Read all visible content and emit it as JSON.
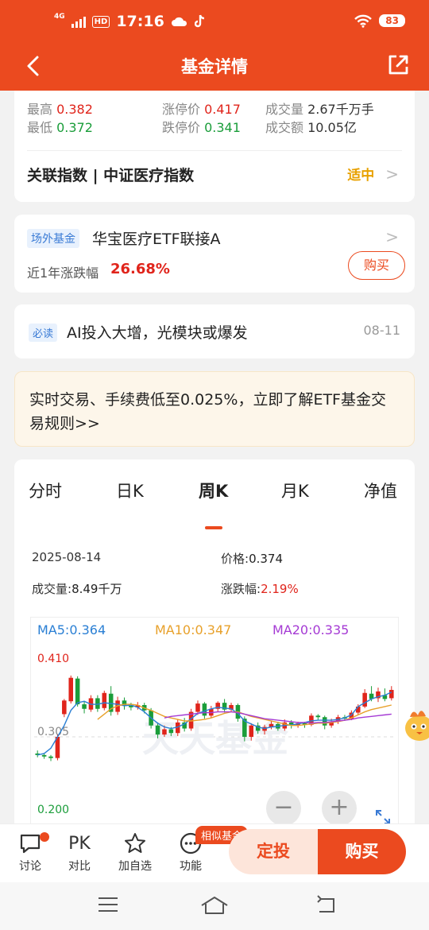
{
  "status_bar": {
    "time": "17:16",
    "network": "4G",
    "hd": "HD",
    "battery": "83"
  },
  "nav": {
    "title": "基金详情"
  },
  "quote": {
    "high_label": "最高",
    "high_value": "0.382",
    "low_label": "最低",
    "low_value": "0.372",
    "limit_up_label": "涨停价",
    "limit_up_value": "0.417",
    "limit_down_label": "跌停价",
    "limit_down_value": "0.341",
    "volume_label": "成交量",
    "volume_value": "2.67千万手",
    "turnover_label": "成交额",
    "turnover_value": "10.05亿",
    "index_label": "关联指数 | 中证医疗指数",
    "risk_level": "适中"
  },
  "fund_card": {
    "tag": "场外基金",
    "name": "华宝医疗ETF联接A",
    "perf_label": "近1年涨跌幅",
    "perf_value": "26.68%",
    "buy_label": "购买"
  },
  "news": {
    "tag": "必读",
    "text": "AI投入大增，光模块或爆发",
    "date": "08-11"
  },
  "notice": {
    "text": "实时交易、手续费低至0.025%，立即了解ETF基金交易规则>>"
  },
  "chart_tabs": [
    "分时",
    "日K",
    "周K",
    "月K",
    "净值"
  ],
  "active_tab": "周K",
  "chart_info": {
    "date": "2025-08-14",
    "price_label": "价格:",
    "price_value": "0.374",
    "volume_label": "成交量:",
    "volume_value": "8.49千万",
    "change_label": "涨跌幅:",
    "change_value": "2.19%"
  },
  "ma": {
    "ma5": "MA5:0.364",
    "ma10": "MA10:0.347",
    "ma20": "MA20:0.335"
  },
  "colors": {
    "ma5": "#2a7fd4",
    "ma10": "#e8a12b",
    "ma20": "#a53ad4",
    "up": "#e0241b",
    "down": "#1a9d3a",
    "brand": "#eb4a1f"
  },
  "watermark": "天天基金",
  "chart_data": {
    "type": "candlestick",
    "ylim": [
      0.2,
      0.41
    ],
    "y_ticks": [
      "0.410",
      "0.305",
      "0.200"
    ],
    "candles": [
      {
        "o": 0.283,
        "c": 0.281,
        "h": 0.287,
        "l": 0.278
      },
      {
        "o": 0.281,
        "c": 0.279,
        "h": 0.283,
        "l": 0.276
      },
      {
        "o": 0.279,
        "c": 0.277,
        "h": 0.281,
        "l": 0.273
      },
      {
        "o": 0.277,
        "c": 0.305,
        "h": 0.308,
        "l": 0.274
      },
      {
        "o": 0.335,
        "c": 0.353,
        "h": 0.355,
        "l": 0.331
      },
      {
        "o": 0.352,
        "c": 0.383,
        "h": 0.386,
        "l": 0.349
      },
      {
        "o": 0.382,
        "c": 0.348,
        "h": 0.385,
        "l": 0.345
      },
      {
        "o": 0.348,
        "c": 0.342,
        "h": 0.352,
        "l": 0.336
      },
      {
        "o": 0.341,
        "c": 0.356,
        "h": 0.36,
        "l": 0.338
      },
      {
        "o": 0.356,
        "c": 0.342,
        "h": 0.36,
        "l": 0.338
      },
      {
        "o": 0.343,
        "c": 0.363,
        "h": 0.366,
        "l": 0.34
      },
      {
        "o": 0.362,
        "c": 0.338,
        "h": 0.372,
        "l": 0.333
      },
      {
        "o": 0.338,
        "c": 0.353,
        "h": 0.358,
        "l": 0.334
      },
      {
        "o": 0.353,
        "c": 0.346,
        "h": 0.357,
        "l": 0.341
      },
      {
        "o": 0.346,
        "c": 0.344,
        "h": 0.35,
        "l": 0.34
      },
      {
        "o": 0.344,
        "c": 0.347,
        "h": 0.351,
        "l": 0.341
      },
      {
        "o": 0.347,
        "c": 0.34,
        "h": 0.35,
        "l": 0.336
      },
      {
        "o": 0.34,
        "c": 0.32,
        "h": 0.343,
        "l": 0.316
      },
      {
        "o": 0.32,
        "c": 0.308,
        "h": 0.324,
        "l": 0.303
      },
      {
        "o": 0.308,
        "c": 0.315,
        "h": 0.32,
        "l": 0.305
      },
      {
        "o": 0.315,
        "c": 0.31,
        "h": 0.318,
        "l": 0.306
      },
      {
        "o": 0.31,
        "c": 0.324,
        "h": 0.328,
        "l": 0.306
      },
      {
        "o": 0.324,
        "c": 0.316,
        "h": 0.33,
        "l": 0.312
      },
      {
        "o": 0.316,
        "c": 0.338,
        "h": 0.342,
        "l": 0.313
      },
      {
        "o": 0.338,
        "c": 0.349,
        "h": 0.353,
        "l": 0.334
      },
      {
        "o": 0.349,
        "c": 0.333,
        "h": 0.351,
        "l": 0.329
      },
      {
        "o": 0.333,
        "c": 0.342,
        "h": 0.346,
        "l": 0.33
      },
      {
        "o": 0.342,
        "c": 0.35,
        "h": 0.352,
        "l": 0.338
      },
      {
        "o": 0.35,
        "c": 0.341,
        "h": 0.355,
        "l": 0.337
      },
      {
        "o": 0.341,
        "c": 0.347,
        "h": 0.35,
        "l": 0.338
      },
      {
        "o": 0.347,
        "c": 0.329,
        "h": 0.349,
        "l": 0.325
      },
      {
        "o": 0.329,
        "c": 0.305,
        "h": 0.332,
        "l": 0.299
      },
      {
        "o": 0.305,
        "c": 0.32,
        "h": 0.323,
        "l": 0.3
      },
      {
        "o": 0.32,
        "c": 0.313,
        "h": 0.324,
        "l": 0.309
      },
      {
        "o": 0.313,
        "c": 0.318,
        "h": 0.321,
        "l": 0.308
      },
      {
        "o": 0.318,
        "c": 0.322,
        "h": 0.326,
        "l": 0.315
      },
      {
        "o": 0.322,
        "c": 0.316,
        "h": 0.325,
        "l": 0.313
      },
      {
        "o": 0.316,
        "c": 0.324,
        "h": 0.328,
        "l": 0.313
      },
      {
        "o": 0.324,
        "c": 0.32,
        "h": 0.327,
        "l": 0.316
      },
      {
        "o": 0.32,
        "c": 0.323,
        "h": 0.325,
        "l": 0.317
      },
      {
        "o": 0.323,
        "c": 0.321,
        "h": 0.325,
        "l": 0.317
      },
      {
        "o": 0.321,
        "c": 0.333,
        "h": 0.336,
        "l": 0.319
      },
      {
        "o": 0.333,
        "c": 0.331,
        "h": 0.335,
        "l": 0.327
      },
      {
        "o": 0.331,
        "c": 0.32,
        "h": 0.333,
        "l": 0.315
      },
      {
        "o": 0.32,
        "c": 0.325,
        "h": 0.329,
        "l": 0.317
      },
      {
        "o": 0.325,
        "c": 0.331,
        "h": 0.334,
        "l": 0.322
      },
      {
        "o": 0.331,
        "c": 0.329,
        "h": 0.334,
        "l": 0.326
      },
      {
        "o": 0.329,
        "c": 0.337,
        "h": 0.34,
        "l": 0.327
      },
      {
        "o": 0.337,
        "c": 0.345,
        "h": 0.348,
        "l": 0.334
      },
      {
        "o": 0.345,
        "c": 0.363,
        "h": 0.368,
        "l": 0.343
      },
      {
        "o": 0.362,
        "c": 0.355,
        "h": 0.372,
        "l": 0.352
      },
      {
        "o": 0.356,
        "c": 0.365,
        "h": 0.37,
        "l": 0.351
      },
      {
        "o": 0.36,
        "c": 0.355,
        "h": 0.369,
        "l": 0.352
      },
      {
        "o": 0.356,
        "c": 0.367,
        "h": 0.372,
        "l": 0.353
      }
    ],
    "ma5": [
      0.281,
      0.283,
      0.29,
      0.305,
      0.32,
      0.34,
      0.35,
      0.352,
      0.348,
      0.348,
      0.35,
      0.349,
      0.348,
      0.346,
      0.347,
      0.344,
      0.338,
      0.33,
      0.323,
      0.318,
      0.316,
      0.318,
      0.322,
      0.329,
      0.336,
      0.339,
      0.342,
      0.344,
      0.343,
      0.342,
      0.336,
      0.326,
      0.322,
      0.318,
      0.316,
      0.318,
      0.319,
      0.32,
      0.321,
      0.322,
      0.324,
      0.326,
      0.327,
      0.327,
      0.327,
      0.328,
      0.33,
      0.334,
      0.345,
      0.35,
      0.355,
      0.358,
      0.36,
      0.364
    ],
    "ma10": [
      null,
      null,
      null,
      null,
      null,
      null,
      null,
      null,
      null,
      0.328,
      0.335,
      0.342,
      0.346,
      0.348,
      0.348,
      0.347,
      0.343,
      0.34,
      0.336,
      0.332,
      0.33,
      0.328,
      0.326,
      0.326,
      0.327,
      0.328,
      0.33,
      0.333,
      0.336,
      0.338,
      0.338,
      0.335,
      0.332,
      0.33,
      0.328,
      0.326,
      0.324,
      0.322,
      0.32,
      0.32,
      0.321,
      0.322,
      0.323,
      0.323,
      0.324,
      0.325,
      0.327,
      0.33,
      0.334,
      0.338,
      0.341,
      0.343,
      0.345,
      0.347
    ],
    "ma20": [
      null,
      null,
      null,
      null,
      null,
      null,
      null,
      null,
      null,
      null,
      null,
      null,
      null,
      null,
      null,
      null,
      null,
      null,
      null,
      0.33,
      0.332,
      0.333,
      0.334,
      0.335,
      0.336,
      0.337,
      0.337,
      0.338,
      0.338,
      0.338,
      0.337,
      0.335,
      0.333,
      0.331,
      0.329,
      0.328,
      0.327,
      0.326,
      0.325,
      0.324,
      0.324,
      0.323,
      0.324,
      0.324,
      0.325,
      0.326,
      0.327,
      0.328,
      0.33,
      0.331,
      0.332,
      0.333,
      0.334,
      0.335
    ]
  },
  "bottom_bar": {
    "discuss": "讨论",
    "pk_icon": "PK",
    "compare": "对比",
    "favorite": "加自选",
    "functions": "功能",
    "similar_tag": "相似基金",
    "dingtou": "定投",
    "buy": "购买"
  }
}
